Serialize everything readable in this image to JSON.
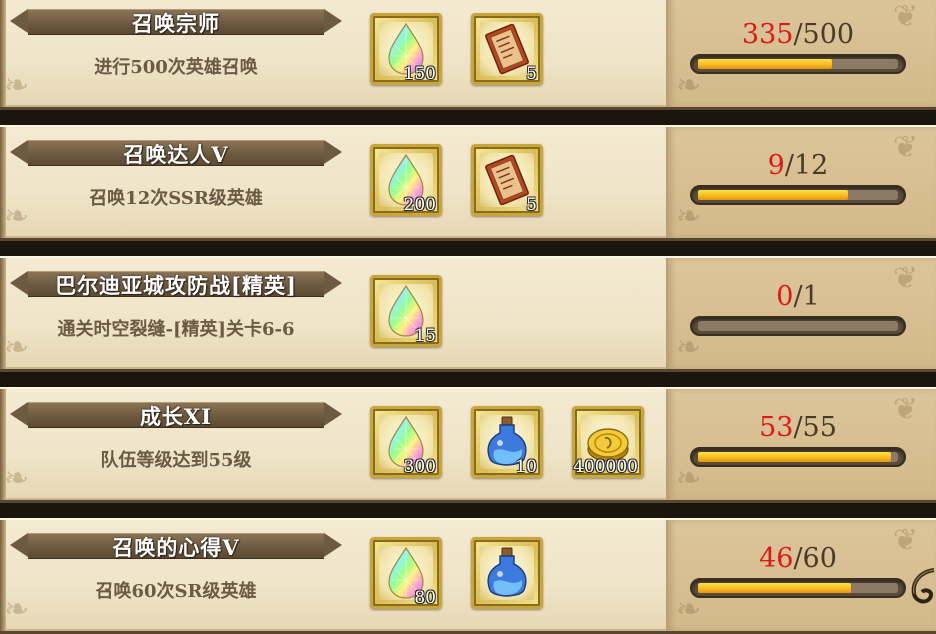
{
  "quests": [
    {
      "title": "召唤宗师",
      "description": "进行500次英雄召唤",
      "rewards": [
        {
          "icon": "rainbow-crystal-icon",
          "qty": "150"
        },
        {
          "icon": "summon-ticket-icon",
          "qty": "5"
        }
      ],
      "progress_current": "335",
      "progress_sep": "/",
      "progress_total": "500",
      "progress_fraction": 0.67
    },
    {
      "title": "召唤达人V",
      "description": "召唤12次SSR级英雄",
      "rewards": [
        {
          "icon": "rainbow-crystal-icon",
          "qty": "200"
        },
        {
          "icon": "summon-ticket-icon",
          "qty": "5"
        }
      ],
      "progress_current": "9",
      "progress_sep": "/",
      "progress_total": "12",
      "progress_fraction": 0.75
    },
    {
      "title": "巴尔迪亚城攻防战[精英]",
      "description": "通关时空裂缝-[精英]关卡6-6",
      "rewards": [
        {
          "icon": "rainbow-crystal-icon",
          "qty": "15"
        }
      ],
      "progress_current": "0",
      "progress_sep": "/",
      "progress_total": "1",
      "progress_fraction": 0
    },
    {
      "title": "成长XI",
      "description": "队伍等级达到55级",
      "rewards": [
        {
          "icon": "rainbow-crystal-icon",
          "qty": "300"
        },
        {
          "icon": "blue-potion-icon",
          "qty": "10"
        },
        {
          "icon": "gold-coin-icon",
          "qty": "400000"
        }
      ],
      "progress_current": "53",
      "progress_sep": "/",
      "progress_total": "55",
      "progress_fraction": 0.964
    },
    {
      "title": "召唤的心得V",
      "description": "召唤60次SR级英雄",
      "rewards": [
        {
          "icon": "rainbow-crystal-icon",
          "qty": "80"
        },
        {
          "icon": "blue-potion-icon",
          "qty": ""
        }
      ],
      "progress_current": "46",
      "progress_sep": "/",
      "progress_total": "60",
      "progress_fraction": 0.767
    }
  ],
  "colors": {
    "progress_current": "#e01818",
    "bar_fill": "#f5b81c",
    "banner": "#6d5a40"
  }
}
